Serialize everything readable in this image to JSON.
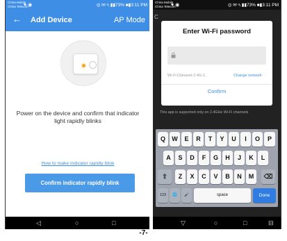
{
  "left_screen": {
    "status": {
      "carrier_line1": "China Mobile",
      "carrier_line2": "China Telecom",
      "icons": "♥ ◉",
      "right": "◎ ✉ ᵃᵢ ▮▮73% ■▮3:11 PM"
    },
    "header": {
      "back_icon": "←",
      "title": "Add Device",
      "mode": "AP Mode"
    },
    "instruction": "Power on the device and confirm that indicator light rapidly blinks",
    "help_link": "How to make indicator rapidly blink",
    "confirm_button": "Confirm indicator rapidly blink"
  },
  "right_screen": {
    "status": {
      "carrier_line1": "China Mobile",
      "carrier_line2": "China Telecom",
      "icons": "♥ ◉",
      "right": "◎ ✉ ᵃᵢ ▮▮73% ■▮3:11 PM"
    },
    "background_letter": "C",
    "dialog": {
      "title": "Enter Wi-Fi password",
      "password_value": "",
      "wifi_label": "Wi-Fi:Chinanet-2.4G-1..",
      "change_network": "Change network",
      "confirm": "Confirm"
    },
    "note": "This app is supported only on 2.4GHz Wi-Fi channels",
    "keyboard": {
      "row1": [
        "Q",
        "W",
        "E",
        "R",
        "T",
        "Y",
        "U",
        "I",
        "O",
        "P"
      ],
      "row2": [
        "A",
        "S",
        "D",
        "F",
        "G",
        "H",
        "J",
        "K",
        "L"
      ],
      "row3": [
        "Z",
        "X",
        "C",
        "V",
        "B",
        "N",
        "M"
      ],
      "shift_icon": "⇧",
      "backspace_icon": "⌫",
      "num_key": "123",
      "globe_icon": "🌐",
      "mic_icon": "🎤",
      "space": "space",
      "done": "Done"
    }
  },
  "navbar": {
    "back_icon": "◁",
    "home_icon": "○",
    "recent_icon": "□",
    "back_icon_right": "▽",
    "home_icon_right": "○",
    "recent_icon_right": "□",
    "extra_icon_right": "⊟"
  },
  "page_number": "-7-",
  "colors": {
    "accent": "#3f8ee6",
    "button": "#4a9ae8",
    "led": "#f5a623",
    "keyboard_bg": "#9ea3ad",
    "done_key": "#2f7de2"
  }
}
